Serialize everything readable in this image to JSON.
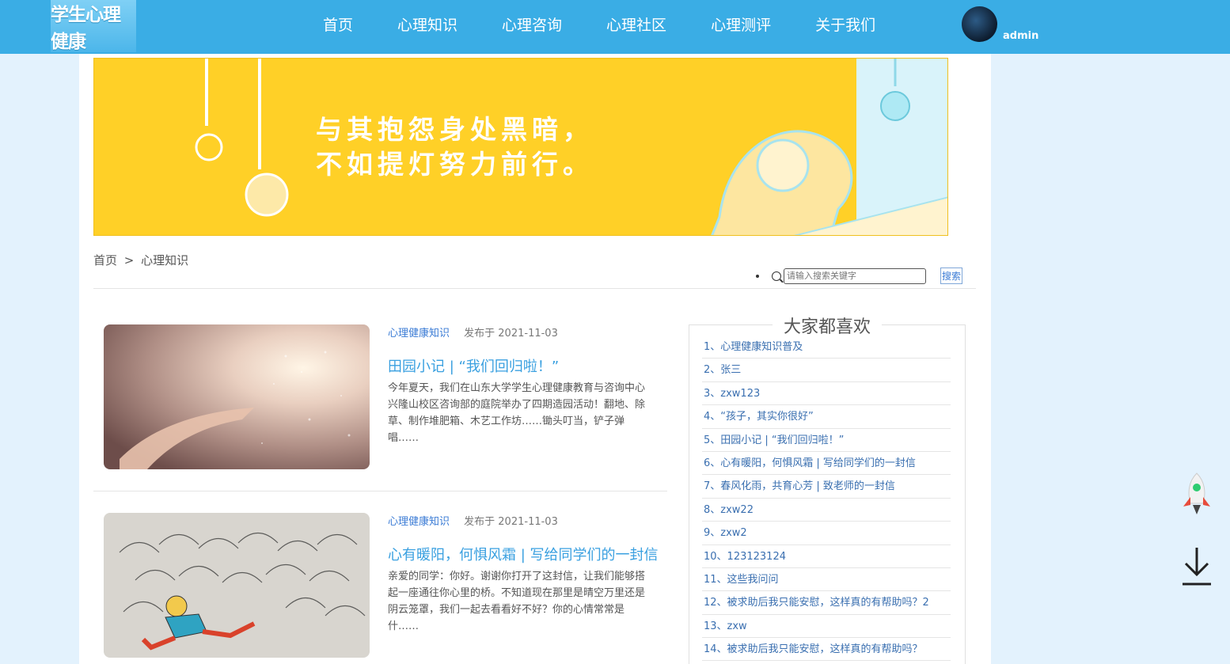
{
  "header": {
    "logo_text": "学生心理健康",
    "nav": [
      "首页",
      "心理知识",
      "心理咨询",
      "心理社区",
      "心理测评",
      "关于我们"
    ],
    "username": "admin"
  },
  "banner": {
    "line1": "与其抱怨身处黑暗，",
    "line2": "不如提灯努力前行。"
  },
  "breadcrumb": {
    "home": "首页",
    "separator": ">",
    "current": "心理知识"
  },
  "search": {
    "placeholder": "请输入搜索关键字",
    "button_label": "搜索"
  },
  "articles": [
    {
      "category": "心理健康知识",
      "date": "发布于 2021-11-03",
      "title": "田园小记 | “我们回归啦！”",
      "excerpt": "今年夏天，我们在山东大学学生心理健康教育与咨询中心兴隆山校区咨询部的庭院举办了四期造园活动！翻地、除草、制作堆肥箱、木艺工作坊……锄头叮当，铲子弹唱……"
    },
    {
      "category": "心理健康知识",
      "date": "发布于 2021-11-03",
      "title": "心有暖阳，何惧风霜 | 写给同学们的一封信",
      "excerpt": "亲爱的同学：你好。谢谢你打开了这封信，让我们能够搭起一座通往你心里的桥。不知道现在那里是晴空万里还是阴云笼罩，我们一起去看看好不好？你的心情常常是什……"
    }
  ],
  "sidebar": {
    "title": "大家都喜欢",
    "items": [
      "1、心理健康知识普及",
      "2、张三",
      "3、zxw123",
      "4、“孩子，其实你很好”",
      "5、田园小记 | “我们回归啦！”",
      "6、心有暖阳，何惧风霜 | 写给同学们的一封信",
      "7、春风化雨，共育心芳 | 致老师的一封信",
      "8、zxw22",
      "9、zxw2",
      "10、123123124",
      "11、这些我问问",
      "12、被求助后我只能安慰，这样真的有帮助吗？2",
      "13、zxw",
      "14、被求助后我只能安慰，这样真的有帮助吗？"
    ]
  },
  "colors": {
    "header_bg": "#3aade5",
    "page_bg": "#e3f2fd",
    "banner_bg": "#ffd027",
    "link_blue": "#3a7bd5",
    "title_blue": "#3aa0e0"
  },
  "icons": {
    "search": "search-icon",
    "rocket": "rocket-icon",
    "download": "download-icon"
  }
}
